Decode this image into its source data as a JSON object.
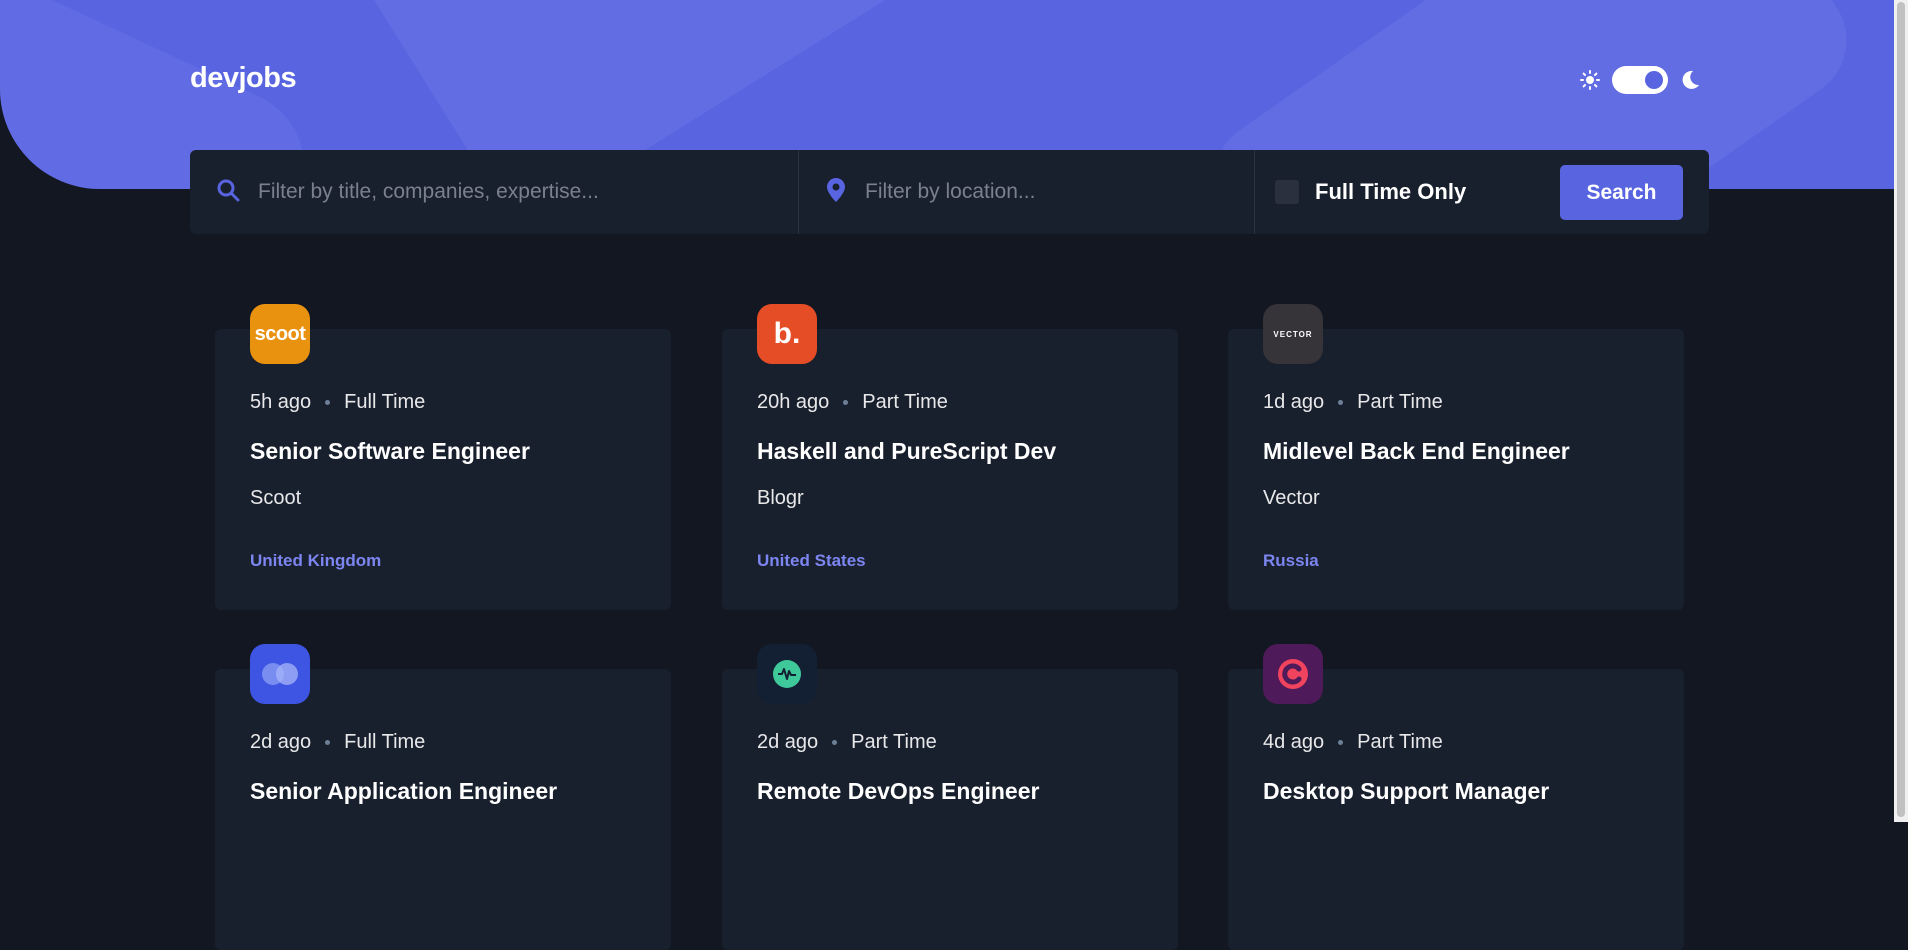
{
  "app": {
    "logo": "devjobs"
  },
  "theme": {
    "light_icon": "sun-icon",
    "dark_icon": "moon-icon",
    "mode": "dark"
  },
  "search": {
    "title_placeholder": "Filter by title, companies, expertise...",
    "location_placeholder": "Filter by location...",
    "full_time_label": "Full Time Only",
    "full_time_checked": false,
    "button_label": "Search"
  },
  "colors": {
    "accent": "#5964e0",
    "background": "#121721",
    "card": "#19202d",
    "location": "#7c85f0"
  },
  "jobs": [
    {
      "posted": "5h ago",
      "contract": "Full Time",
      "position": "Senior Software Engineer",
      "company": "Scoot",
      "location": "United Kingdom",
      "logo_text": "scoot",
      "logo_bg": "#e99210"
    },
    {
      "posted": "20h ago",
      "contract": "Part Time",
      "position": "Haskell and PureScript Dev",
      "company": "Blogr",
      "location": "United States",
      "logo_text": "b.",
      "logo_bg": "#e54d26"
    },
    {
      "posted": "1d ago",
      "contract": "Part Time",
      "position": "Midlevel Back End Engineer",
      "company": "Vector",
      "location": "Russia",
      "logo_text": "VECTOR",
      "logo_bg": "#363339"
    },
    {
      "posted": "2d ago",
      "contract": "Full Time",
      "position": "Senior Application Engineer",
      "company": "",
      "location": "",
      "logo_text": "",
      "logo_bg": "#3e54e3"
    },
    {
      "posted": "2d ago",
      "contract": "Part Time",
      "position": "Remote DevOps Engineer",
      "company": "",
      "location": "",
      "logo_text": "",
      "logo_bg": "#132034"
    },
    {
      "posted": "4d ago",
      "contract": "Part Time",
      "position": "Desktop Support Manager",
      "company": "",
      "location": "",
      "logo_text": "",
      "logo_bg": "#4e1a59"
    }
  ]
}
